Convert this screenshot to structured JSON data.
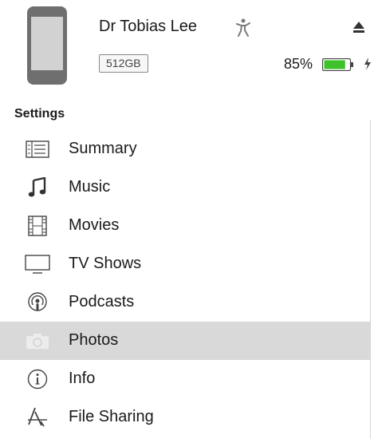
{
  "device": {
    "name": "Dr Tobias Lee",
    "capacity": "512GB",
    "battery_percent": "85%",
    "battery_level": 0.85,
    "battery_color": "#3ec12b"
  },
  "sidebar": {
    "heading": "Settings",
    "selected_color": "#d9d9d9",
    "items": [
      {
        "label": "Summary",
        "icon": "summary-icon"
      },
      {
        "label": "Music",
        "icon": "music-note-icon"
      },
      {
        "label": "Movies",
        "icon": "film-icon"
      },
      {
        "label": "TV Shows",
        "icon": "tv-icon"
      },
      {
        "label": "Podcasts",
        "icon": "podcast-icon"
      },
      {
        "label": "Photos",
        "icon": "camera-icon",
        "selected": true
      },
      {
        "label": "Info",
        "icon": "info-icon"
      },
      {
        "label": "File Sharing",
        "icon": "app-store-icon"
      }
    ]
  }
}
